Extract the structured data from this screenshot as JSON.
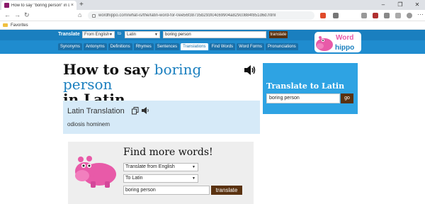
{
  "browser": {
    "tab_title": "How to say \"boring person\" in Lat",
    "tab_close": "×",
    "new_tab": "+",
    "url": "wordhippo.com/what-is/the/latin-word-for-0ee56f38735b293fc4c69904a829c0884f851d6d.html",
    "favorites_label": "Favorites",
    "window_controls": [
      "–",
      "❐",
      "✕"
    ]
  },
  "header": {
    "translate_label": "Translate",
    "from_select": "From English",
    "to_label": "to",
    "to_select": "Latin",
    "search_value": "boring person",
    "translate_button": "translate",
    "logo_top": "Word",
    "logo_bottom": "hippo",
    "tabs": [
      "Synonyms",
      "Antonyms",
      "Definitions",
      "Rhymes",
      "Sentences",
      "Translations",
      "Find Words",
      "Word Forms",
      "Pronunciations"
    ],
    "active_tab": "Translations"
  },
  "main": {
    "heading_prefix": "How to say",
    "heading_term": "boring person",
    "heading_suffix": "in Latin",
    "translation_title": "Latin Translation",
    "translation_word": "odiosis hominem"
  },
  "sidebar": {
    "title": "Translate to Latin",
    "input_value": "boring person",
    "go_button": "go"
  },
  "find_more": {
    "title": "Find more words!",
    "from_select": "Translate from English",
    "to_select": "To Latin",
    "input_value": "boring person",
    "button": "translate"
  },
  "colors": {
    "header_blue": "#1f8ccf",
    "sidebar_blue": "#2ea3e3",
    "button_brown": "#5a3210",
    "translation_bg": "#d6eaf8",
    "hippo_pink": "#e85aa8"
  }
}
